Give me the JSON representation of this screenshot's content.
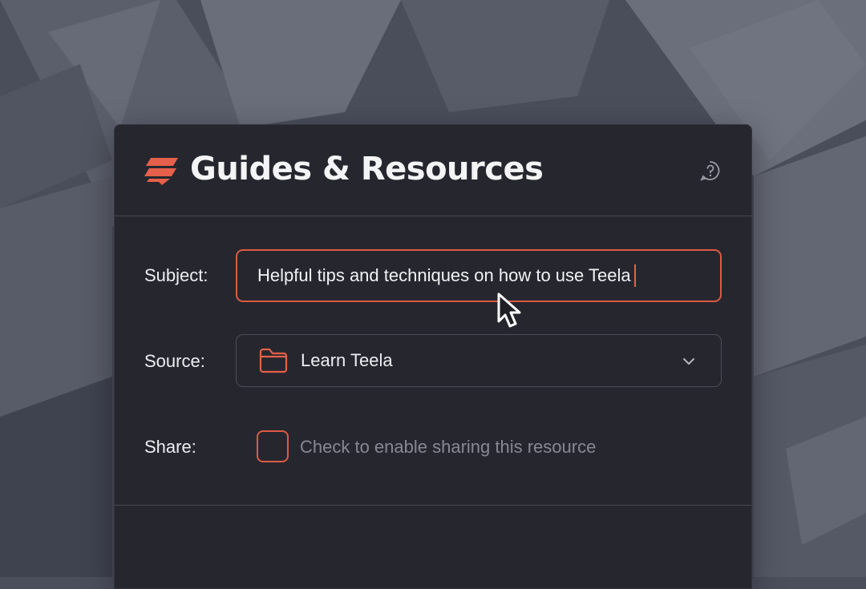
{
  "header": {
    "title": "Guides & Resources",
    "logo": "teela-logo",
    "help_icon": "help-chat-icon"
  },
  "form": {
    "subject": {
      "label": "Subject:",
      "value": "Helpful tips and techniques on how to use Teela"
    },
    "source": {
      "label": "Source:",
      "value": "Learn Teela",
      "icon": "folder-icon"
    },
    "share": {
      "label": "Share:",
      "checkbox_hint": "Check to enable sharing this resource",
      "checked": false
    }
  },
  "colors": {
    "accent": "#dc5a45",
    "panel_bg": "#26272e",
    "page_bg": "#4b4f5c"
  }
}
